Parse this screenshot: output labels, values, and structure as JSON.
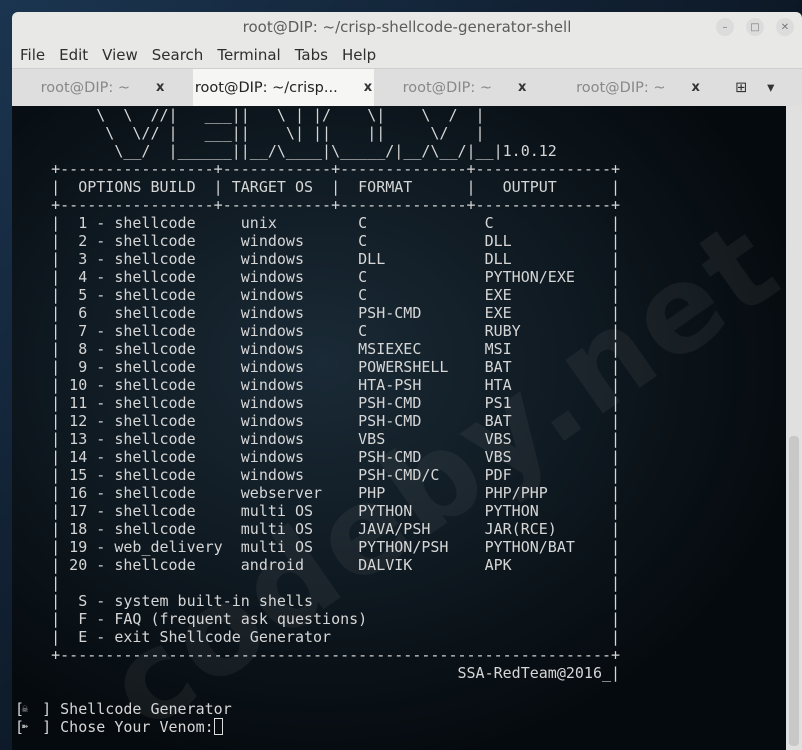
{
  "window": {
    "title": "root@DIP: ~/crisp-shellcode-generator-shell"
  },
  "menu": [
    "File",
    "Edit",
    "View",
    "Search",
    "Terminal",
    "Tabs",
    "Help"
  ],
  "tabs": [
    {
      "label": "root@DIP: ~",
      "active": false
    },
    {
      "label": "root@DIP: ~/crisp...",
      "active": true
    },
    {
      "label": "root@DIP: ~",
      "active": false
    },
    {
      "label": "root@DIP: ~",
      "active": false
    }
  ],
  "art": [
    "\\  \\  //|   ___||   \\ | |/    \\|    \\  /  |",
    "\\  \\// |   ___||    \\| ||    ||     \\/   |",
    "\\__/  |______||__/\\____|\\_____/|__/\\__/|__|"
  ],
  "version": "1.0.12",
  "headers": [
    "OPTIONS BUILD",
    "TARGET OS",
    "FORMAT",
    "OUTPUT"
  ],
  "rows": [
    {
      "num": "1",
      "sep": "-",
      "build": "shellcode",
      "target": "unix",
      "format": "C",
      "output": "C"
    },
    {
      "num": "2",
      "sep": "-",
      "build": "shellcode",
      "target": "windows",
      "format": "C",
      "output": "DLL"
    },
    {
      "num": "3",
      "sep": "-",
      "build": "shellcode",
      "target": "windows",
      "format": "DLL",
      "output": "DLL"
    },
    {
      "num": "4",
      "sep": "-",
      "build": "shellcode",
      "target": "windows",
      "format": "C",
      "output": "PYTHON/EXE"
    },
    {
      "num": "5",
      "sep": "-",
      "build": "shellcode",
      "target": "windows",
      "format": "C",
      "output": "EXE"
    },
    {
      "num": "6",
      "sep": "",
      "build": "shellcode",
      "target": "windows",
      "format": "PSH-CMD",
      "output": "EXE"
    },
    {
      "num": "7",
      "sep": "-",
      "build": "shellcode",
      "target": "windows",
      "format": "C",
      "output": "RUBY"
    },
    {
      "num": "8",
      "sep": "-",
      "build": "shellcode",
      "target": "windows",
      "format": "MSIEXEC",
      "output": "MSI"
    },
    {
      "num": "9",
      "sep": "-",
      "build": "shellcode",
      "target": "windows",
      "format": "POWERSHELL",
      "output": "BAT"
    },
    {
      "num": "10",
      "sep": "-",
      "build": "shellcode",
      "target": "windows",
      "format": "HTA-PSH",
      "output": "HTA"
    },
    {
      "num": "11",
      "sep": "-",
      "build": "shellcode",
      "target": "windows",
      "format": "PSH-CMD",
      "output": "PS1"
    },
    {
      "num": "12",
      "sep": "-",
      "build": "shellcode",
      "target": "windows",
      "format": "PSH-CMD",
      "output": "BAT"
    },
    {
      "num": "13",
      "sep": "-",
      "build": "shellcode",
      "target": "windows",
      "format": "VBS",
      "output": "VBS"
    },
    {
      "num": "14",
      "sep": "-",
      "build": "shellcode",
      "target": "windows",
      "format": "PSH-CMD",
      "output": "VBS"
    },
    {
      "num": "15",
      "sep": "-",
      "build": "shellcode",
      "target": "windows",
      "format": "PSH-CMD/C",
      "output": "PDF"
    },
    {
      "num": "16",
      "sep": "-",
      "build": "shellcode",
      "target": "webserver",
      "format": "PHP",
      "output": "PHP/PHP"
    },
    {
      "num": "17",
      "sep": "-",
      "build": "shellcode",
      "target": "multi OS",
      "format": "PYTHON",
      "output": "PYTHON"
    },
    {
      "num": "18",
      "sep": "-",
      "build": "shellcode",
      "target": "multi OS",
      "format": "JAVA/PSH",
      "output": "JAR(RCE)"
    },
    {
      "num": "19",
      "sep": "-",
      "build": "web_delivery",
      "target": "multi OS",
      "format": "PYTHON/PSH",
      "output": "PYTHON/BAT"
    },
    {
      "num": "20",
      "sep": "-",
      "build": "shellcode",
      "target": "android",
      "format": "DALVIK",
      "output": "APK"
    }
  ],
  "extras": [
    "S - system built-in shells",
    "F - FAQ (frequent ask questions)",
    "E - exit Shellcode Generator"
  ],
  "credit": "SSA-RedTeam@2016_",
  "prompts": [
    {
      "icon": "☠",
      "text": "Shellcode Generator"
    },
    {
      "icon": "➽",
      "text": "Chose Your Venom:"
    }
  ],
  "watermark": "codeby.net"
}
